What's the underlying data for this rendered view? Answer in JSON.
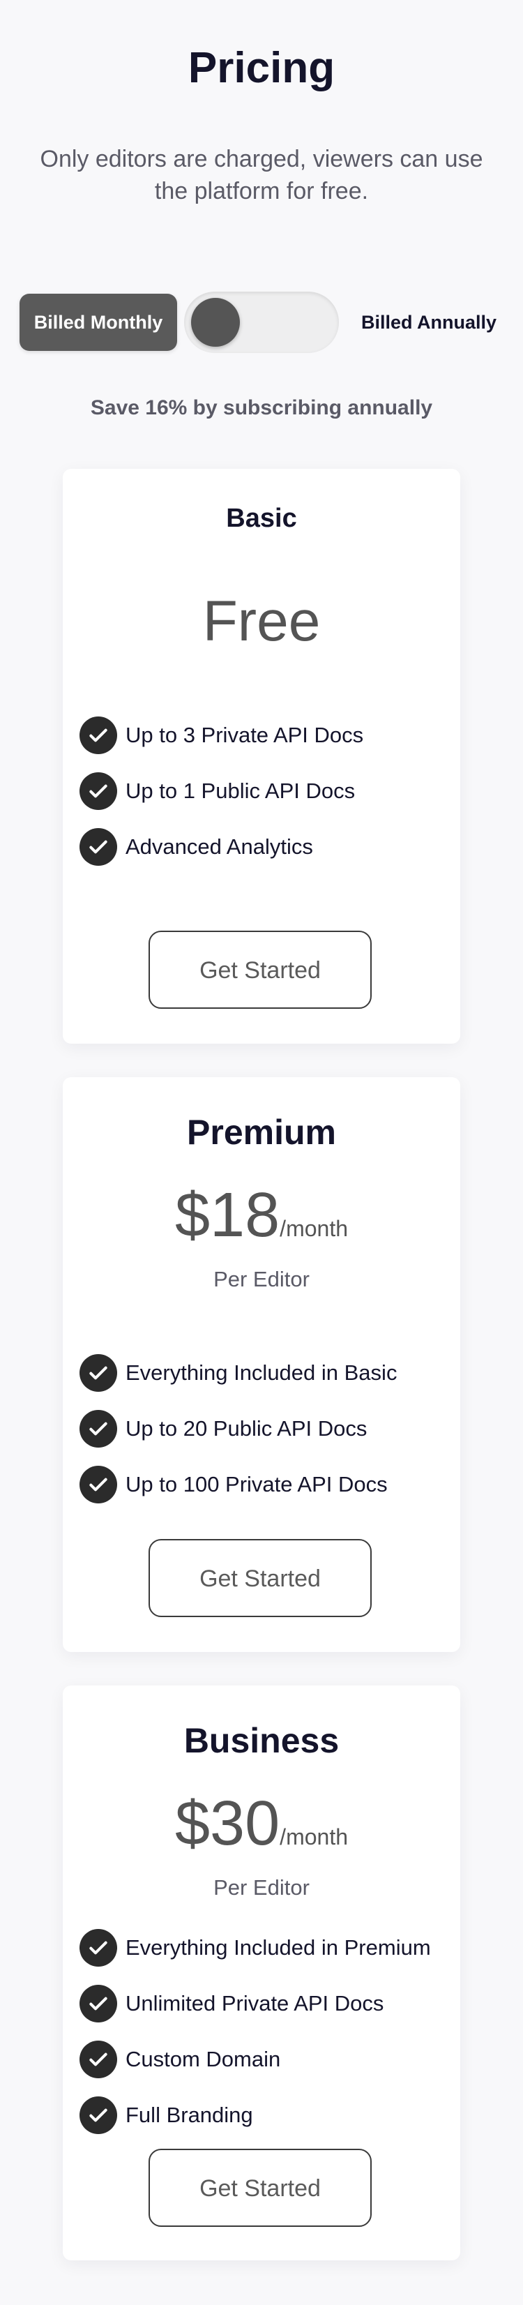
{
  "header": {
    "title": "Pricing",
    "subtitle": "Only editors are charged, viewers can use the platform for free."
  },
  "billing": {
    "monthly_label": "Billed Monthly",
    "annually_label": "Billed Annually",
    "selected": "monthly",
    "save_note": "Save 16% by subscribing annually"
  },
  "plans": [
    {
      "name": "Basic",
      "price": "Free",
      "features": [
        "Up to 3 Private API Docs",
        "Up to 1 Public API Docs",
        "Advanced Analytics"
      ],
      "cta": "Get Started"
    },
    {
      "name": "Premium",
      "price": "$18",
      "period": "/month",
      "per": "Per Editor",
      "features": [
        "Everything Included in Basic",
        "Up to 20 Public API Docs",
        "Up to 100 Private API Docs"
      ],
      "cta": "Get Started"
    },
    {
      "name": "Business",
      "price": "$30",
      "period": "/month",
      "per": "Per Editor",
      "features": [
        "Everything Included in Premium",
        "Unlimited Private API Docs",
        "Custom Domain",
        "Full Branding"
      ],
      "cta": "Get Started"
    }
  ],
  "icons": {
    "feature": "check-circle-icon"
  },
  "colors": {
    "background": "#f8f8fa",
    "title": "#14142b",
    "toggle_active": "#5a5a5a",
    "check": "#2b2b2b"
  }
}
